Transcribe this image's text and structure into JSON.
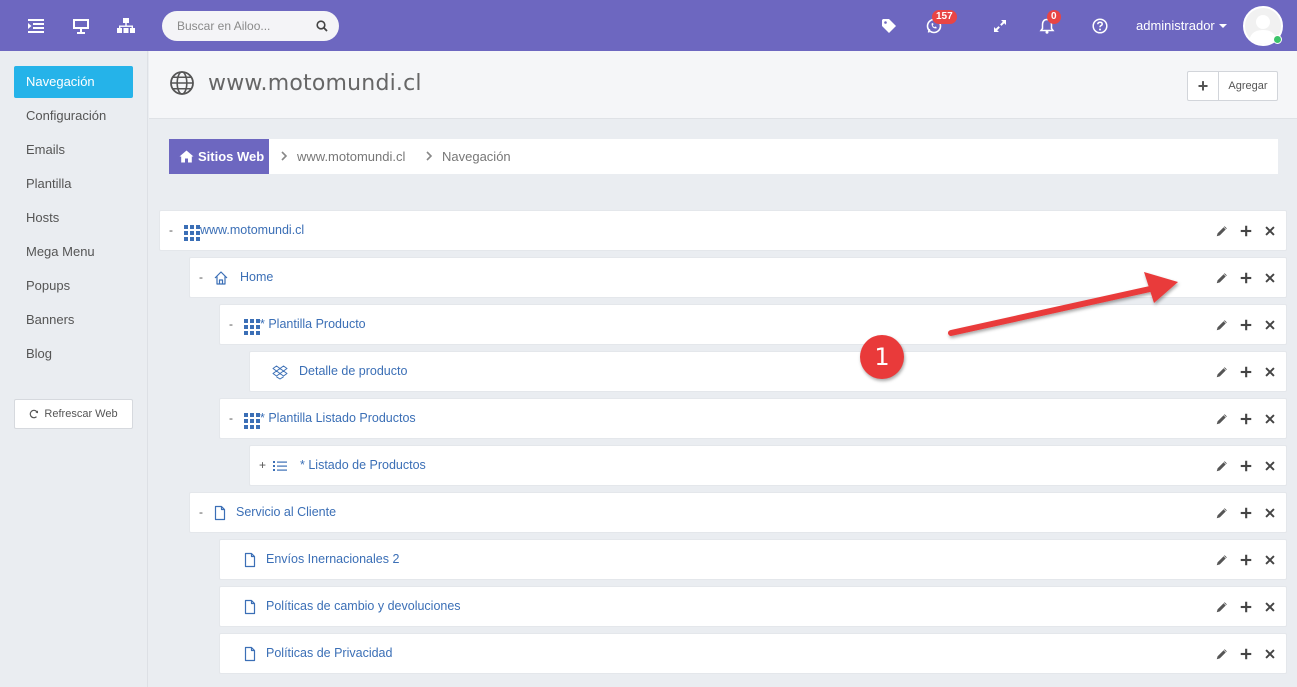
{
  "topbar": {
    "search_placeholder": "Buscar en Ailoo...",
    "whatsapp_count": "157",
    "notification_count": "0",
    "user_name": "administrador",
    "colors": {
      "brand": "#6d67c0",
      "badge": "#e84545"
    }
  },
  "sidebar": {
    "items": [
      {
        "label": "Navegación",
        "active": true
      },
      {
        "label": "Configuración"
      },
      {
        "label": "Emails"
      },
      {
        "label": "Plantilla"
      },
      {
        "label": "Hosts"
      },
      {
        "label": "Mega Menu"
      },
      {
        "label": "Popups"
      },
      {
        "label": "Banners"
      },
      {
        "label": "Blog"
      }
    ],
    "refresh_label": "Refrescar Web",
    "active_color": "#25b3e9"
  },
  "header": {
    "title": "www.motomundi.cl",
    "add_label": "Agregar"
  },
  "breadcrumb": {
    "home": "Sitios Web",
    "items": [
      "www.motomundi.cl",
      "Navegación"
    ]
  },
  "tree": [
    {
      "label": "www.motomundi.cl",
      "toggle": "-",
      "icon": "grid-icon",
      "level": 0
    },
    {
      "label": "Home",
      "toggle": "-",
      "icon": "home-icon",
      "level": 1
    },
    {
      "label": "* Plantilla Producto",
      "toggle": "-",
      "icon": "grid-icon",
      "level": 2
    },
    {
      "label": "Detalle de producto",
      "toggle": "",
      "icon": "dropbox-icon",
      "level": 3
    },
    {
      "label": "* Plantilla Listado Productos",
      "toggle": "-",
      "icon": "grid-icon",
      "level": 2
    },
    {
      "label": "* Listado de Productos",
      "toggle": "+",
      "icon": "list-icon",
      "level": 3
    },
    {
      "label": "Servicio al Cliente",
      "toggle": "-",
      "icon": "file-icon",
      "level": 1
    },
    {
      "label": "Envíos Inernacionales 2",
      "toggle": "",
      "icon": "file-icon",
      "level": 2
    },
    {
      "label": "Políticas de cambio y devoluciones",
      "toggle": "",
      "icon": "file-icon",
      "level": 2
    },
    {
      "label": "Políticas de Privacidad",
      "toggle": "",
      "icon": "file-icon",
      "level": 2
    }
  ],
  "annotation": {
    "number": "1",
    "color": "#e93a3a"
  }
}
